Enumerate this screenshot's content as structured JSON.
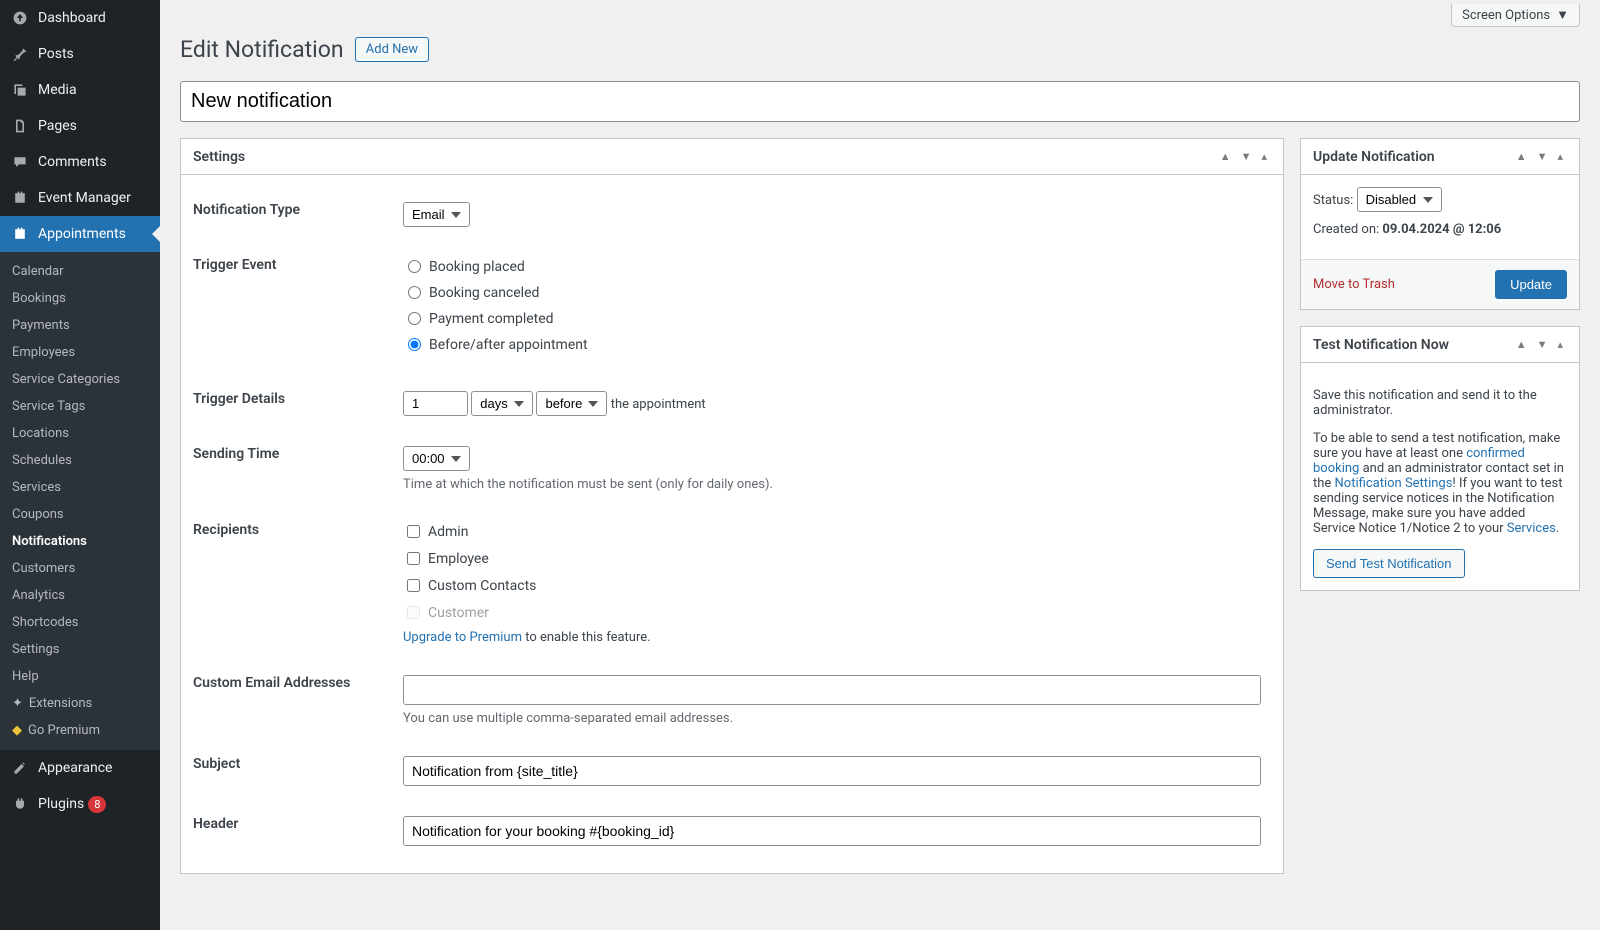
{
  "header": {
    "title": "Edit Notification",
    "addNew": "Add New",
    "screenOptions": "Screen Options",
    "postTitle": "New notification"
  },
  "sidebar": {
    "top": [
      {
        "label": "Dashboard",
        "icon": "dashboard"
      },
      {
        "label": "Posts",
        "icon": "pin"
      },
      {
        "label": "Media",
        "icon": "media"
      },
      {
        "label": "Pages",
        "icon": "pages"
      },
      {
        "label": "Comments",
        "icon": "comment"
      },
      {
        "label": "Event Manager",
        "icon": "calendar"
      },
      {
        "label": "Appointments",
        "icon": "calendar",
        "active": true
      }
    ],
    "sub": [
      "Calendar",
      "Bookings",
      "Payments",
      "Employees",
      "Service Categories",
      "Service Tags",
      "Locations",
      "Schedules",
      "Services",
      "Coupons",
      "Notifications",
      "Customers",
      "Analytics",
      "Shortcodes",
      "Settings",
      "Help"
    ],
    "subCurrent": 10,
    "extensions": "Extensions",
    "goPremium": "Go Premium",
    "bottom": [
      {
        "label": "Appearance",
        "icon": "appearance"
      },
      {
        "label": "Plugins",
        "icon": "plugins",
        "badge": "8"
      }
    ]
  },
  "settings": {
    "panelTitle": "Settings",
    "notificationType": {
      "label": "Notification Type",
      "value": "Email"
    },
    "triggerEvent": {
      "label": "Trigger Event",
      "options": [
        "Booking placed",
        "Booking canceled",
        "Payment completed",
        "Before/after appointment"
      ],
      "selected": 3
    },
    "triggerDetails": {
      "label": "Trigger Details",
      "value": "1",
      "unit": "days",
      "when": "before",
      "suffix": "the appointment"
    },
    "sendingTime": {
      "label": "Sending Time",
      "value": "00:00",
      "hint": "Time at which the notification must be sent (only for daily ones)."
    },
    "recipients": {
      "label": "Recipients",
      "options": [
        "Admin",
        "Employee",
        "Custom Contacts"
      ],
      "disabled": "Customer",
      "upgrade": "Upgrade to Premium",
      "upgradeSuffix": " to enable this feature."
    },
    "customEmail": {
      "label": "Custom Email Addresses",
      "value": "",
      "hint": "You can use multiple comma-separated email addresses."
    },
    "subject": {
      "label": "Subject",
      "value": "Notification from {site_title}"
    },
    "headerField": {
      "label": "Header",
      "value": "Notification for your booking #{booking_id}"
    }
  },
  "updateBox": {
    "title": "Update Notification",
    "statusLabel": "Status:",
    "statusValue": "Disabled",
    "createdLabel": "Created on: ",
    "createdValue": "09.04.2024 @ 12:06",
    "trash": "Move to Trash",
    "update": "Update"
  },
  "testBox": {
    "title": "Test Notification Now",
    "p1": "Save this notification and send it to the administrator.",
    "p2a": "To be able to send a test notification, make sure you have at least one ",
    "link1": "confirmed booking",
    "p2b": " and an administrator contact set in the ",
    "link2": "Notification Settings",
    "p2c": "! If you want to test sending service notices in the Notification Message, make sure you have added Service Notice 1/Notice 2 to your ",
    "link3": "Services",
    "p2d": ".",
    "button": "Send Test Notification"
  }
}
